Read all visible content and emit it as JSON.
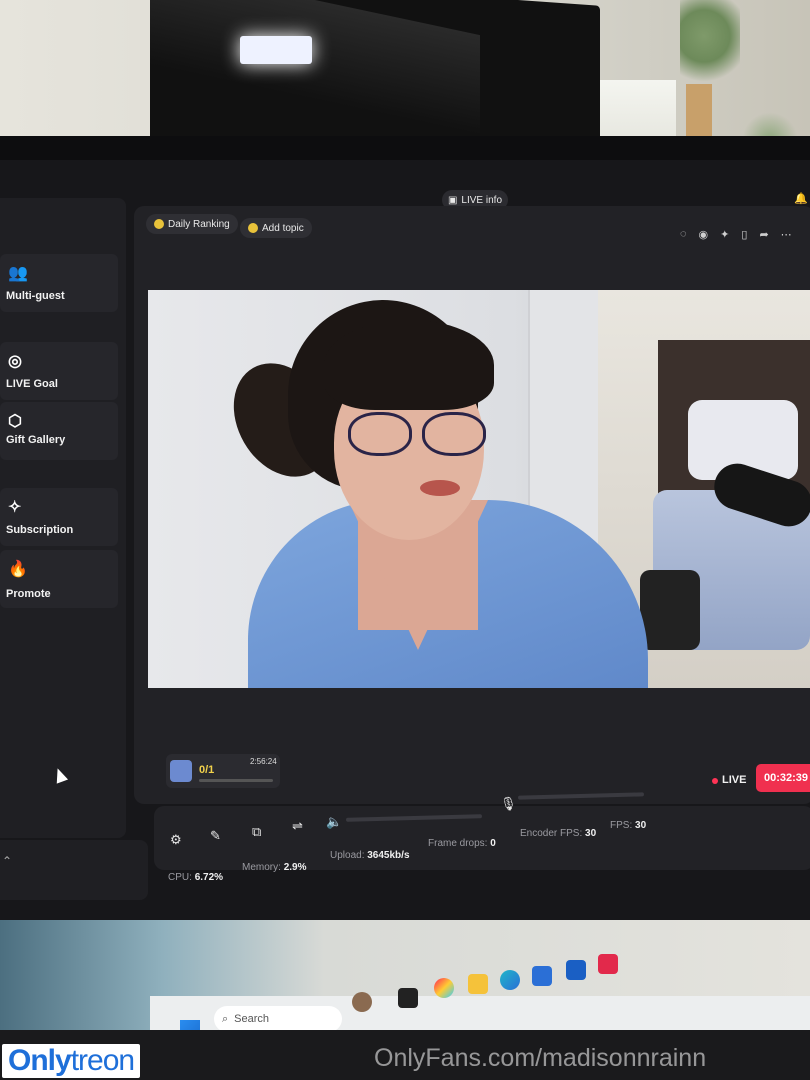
{
  "topbar": {
    "live_info": "LIVE info"
  },
  "header": {
    "daily_ranking": "Daily Ranking",
    "add_topic": "Add topic"
  },
  "sidebar": {
    "items": [
      {
        "label": "Multi-guest",
        "icon": "people-icon"
      },
      {
        "label": "LIVE Goal",
        "icon": "target-icon"
      },
      {
        "label": "Gift Gallery",
        "icon": "gift-icon"
      },
      {
        "label": "Subscription",
        "icon": "star-icon"
      },
      {
        "label": "Promote",
        "icon": "flame-icon"
      }
    ]
  },
  "widget": {
    "count": "0/1",
    "time": "2:56:24"
  },
  "live": {
    "label": "LIVE",
    "timer": "00:32:39",
    "accent": "#f0304f"
  },
  "stats": {
    "cpu_label": "CPU:",
    "cpu": "6.72%",
    "memory_label": "Memory:",
    "memory": "2.9%",
    "upload_label": "Upload:",
    "upload": "3645kb/s",
    "frame_drops_label": "Frame drops:",
    "frame_drops": "0",
    "encoder_fps_label": "Encoder FPS:",
    "encoder_fps": "30",
    "fps_label": "FPS:",
    "fps": "30"
  },
  "taskbar": {
    "search_placeholder": "Search"
  },
  "watermarks": {
    "left_a": "Only",
    "left_b": "treon",
    "right": "OnlyFans.com/madisonnrainn"
  }
}
